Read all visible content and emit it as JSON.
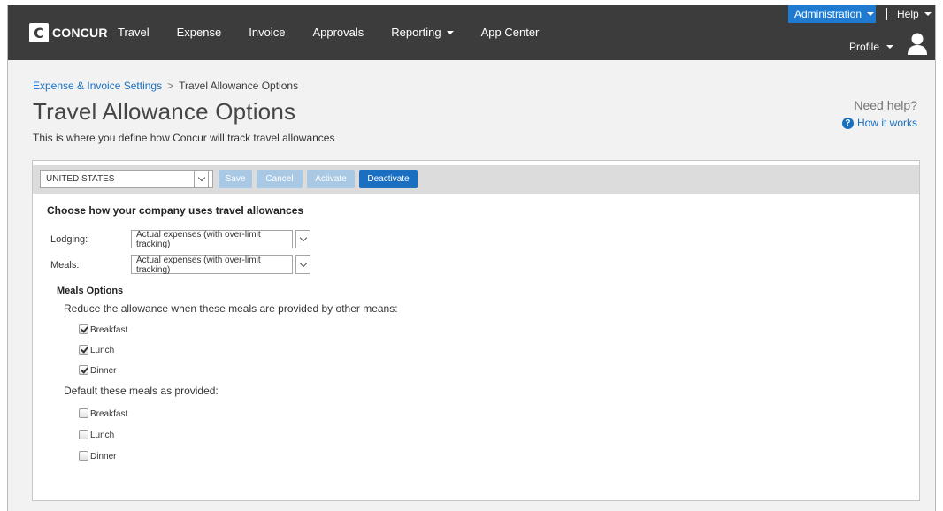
{
  "header": {
    "logo_mark": "C",
    "logo_text": "CONCUR",
    "nav": [
      {
        "label": "Travel"
      },
      {
        "label": "Expense"
      },
      {
        "label": "Invoice"
      },
      {
        "label": "Approvals"
      },
      {
        "label": "Reporting",
        "dropdown": true
      },
      {
        "label": "App Center"
      }
    ],
    "admin_label": "Administration",
    "help_label": "Help",
    "profile_label": "Profile"
  },
  "breadcrumb": {
    "parent": "Expense & Invoice Settings",
    "current": "Travel Allowance Options"
  },
  "page": {
    "title": "Travel Allowance Options",
    "subtitle": "This is where you define how Concur will track travel allowances",
    "need_help": "Need help?",
    "how_it_works": "How it works"
  },
  "toolbar": {
    "country": "UNITED STATES",
    "save": "Save",
    "cancel": "Cancel",
    "activate": "Activate",
    "deactivate": "Deactivate"
  },
  "form": {
    "heading": "Choose how your company uses travel allowances",
    "lodging_label": "Lodging:",
    "lodging_value": "Actual expenses (with over-limit tracking)",
    "meals_label": "Meals:",
    "meals_value": "Actual expenses (with over-limit tracking)"
  },
  "meals_options": {
    "heading": "Meals Options",
    "reduce_label": "Reduce the allowance when these meals are provided by other means:",
    "reduce": [
      {
        "label": "Breakfast",
        "checked": true
      },
      {
        "label": "Lunch",
        "checked": true
      },
      {
        "label": "Dinner",
        "checked": true
      }
    ],
    "default_label": "Default these meals as provided:",
    "default": [
      {
        "label": "Breakfast",
        "checked": false
      },
      {
        "label": "Lunch",
        "checked": false
      },
      {
        "label": "Dinner",
        "checked": false
      }
    ]
  },
  "colors": {
    "header_bg": "#3c3c3c",
    "accent": "#1a6fc1",
    "admin_bg": "#1f7bd0",
    "disabled_btn": "#a8c8e4"
  }
}
